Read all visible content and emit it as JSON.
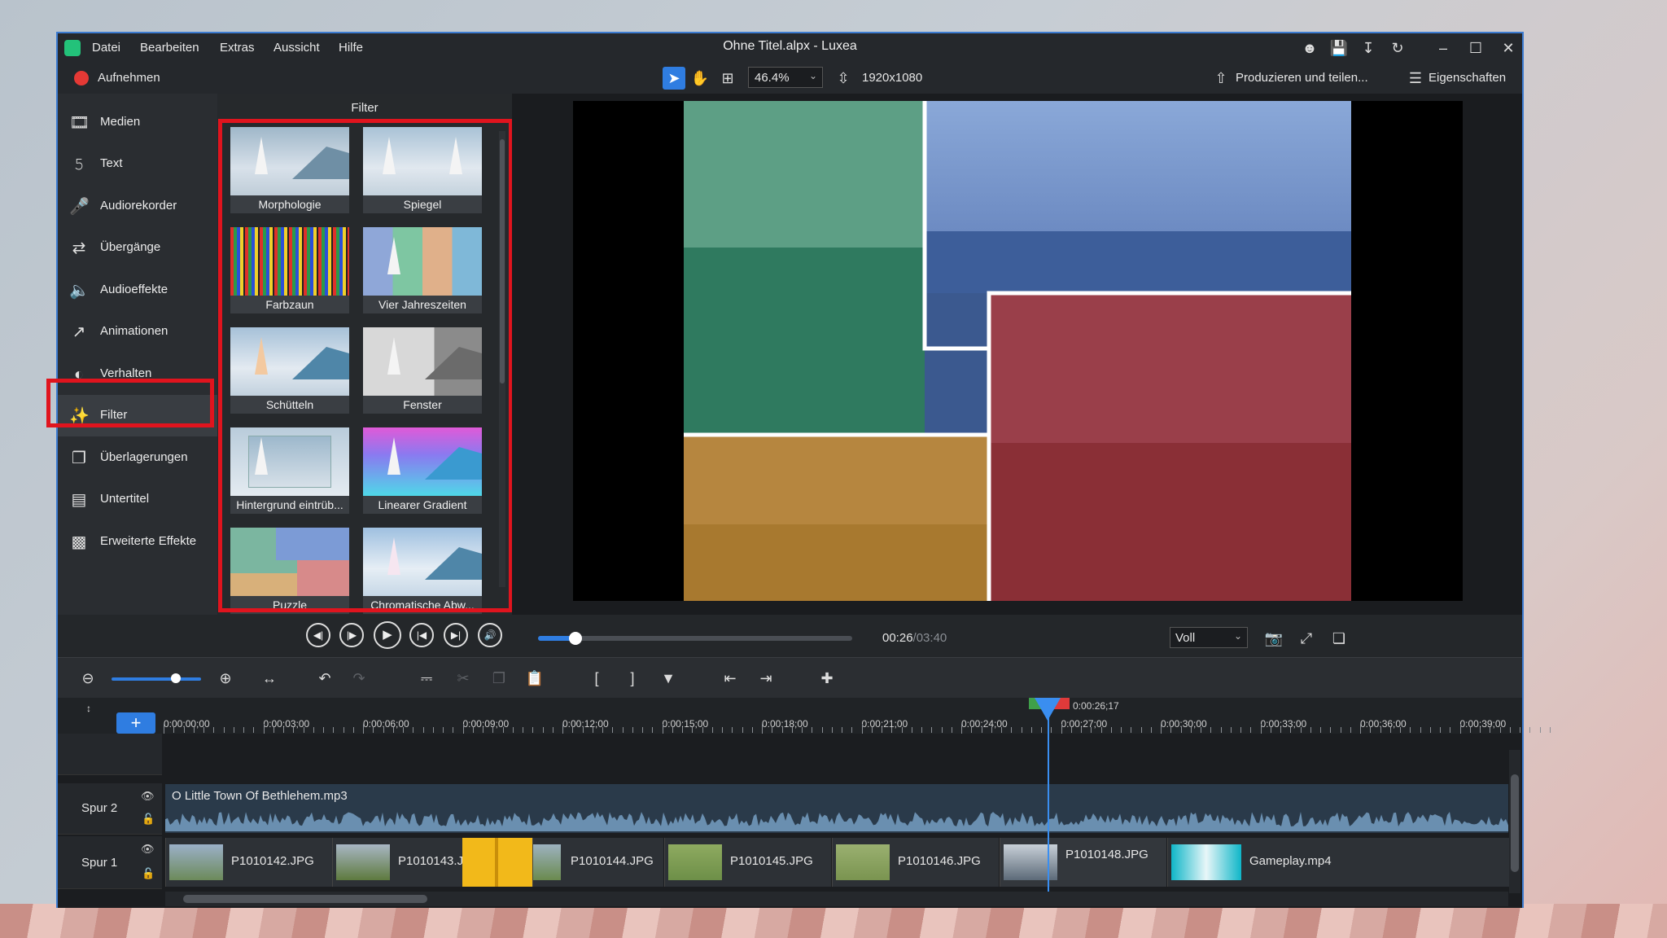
{
  "window": {
    "title": "Ohne Titel.alpx - Luxea",
    "menu": [
      "Datei",
      "Bearbeiten",
      "Extras",
      "Aussicht",
      "Hilfe"
    ]
  },
  "toolbar": {
    "record_label": "Aufnehmen",
    "zoom_value": "46.4%",
    "resolution": "1920x1080",
    "produce_label": "Produzieren und teilen...",
    "properties_label": "Eigenschaften"
  },
  "sidebar": {
    "items": [
      {
        "label": "Medien",
        "icon": "film-icon"
      },
      {
        "label": "Text",
        "icon": "text-icon"
      },
      {
        "label": "Audiorekorder",
        "icon": "microphone-icon"
      },
      {
        "label": "Übergänge",
        "icon": "transition-icon"
      },
      {
        "label": "Audioeffekte",
        "icon": "speaker-icon"
      },
      {
        "label": "Animationen",
        "icon": "arrow-icon"
      },
      {
        "label": "Verhalten",
        "icon": "behavior-icon"
      },
      {
        "label": "Filter",
        "icon": "wand-icon",
        "active": true
      },
      {
        "label": "Überlagerungen",
        "icon": "overlay-icon"
      },
      {
        "label": "Untertitel",
        "icon": "subtitle-icon"
      },
      {
        "label": "Erweiterte Effekte",
        "icon": "effects-icon"
      }
    ]
  },
  "filter_panel": {
    "title": "Filter",
    "items": [
      "Morphologie",
      "Spiegel",
      "Farbzaun",
      "Vier Jahreszeiten",
      "Schütteln",
      "Fenster",
      "Hintergrund eintrüb...",
      "Linearer Gradient",
      "Puzzle",
      "Chromatische Abw..."
    ]
  },
  "transport": {
    "time_current": "00:26",
    "time_total": "/03:40",
    "quality": "Voll",
    "progress": 0.118
  },
  "timeline": {
    "playhead_time": "0:00:26;17",
    "ticks": [
      "0:00:00;00",
      "0:00:03;00",
      "0:00:06;00",
      "0:00:09;00",
      "0:00:12;00",
      "0:00:15;00",
      "0:00:18;00",
      "0:00:21;00",
      "0:00:24;00",
      "0:00:27;00",
      "0:00:30;00",
      "0:00:33;00",
      "0:00:36;00",
      "0:00:39;00"
    ],
    "tracks": [
      {
        "name": "Spur 2",
        "audio_clip": "O Little Town Of Bethlehem.mp3"
      },
      {
        "name": "Spur 1",
        "clips": [
          "P1010142.JPG",
          "P1010143.J",
          "P1010144.JPG",
          "P1010145.JPG",
          "P1010146.JPG",
          "P1010148.JPG",
          "Gameplay.mp4"
        ]
      }
    ]
  },
  "colors": {
    "accent": "#2f7de1",
    "highlight": "#e0141e",
    "record": "#e53935"
  }
}
